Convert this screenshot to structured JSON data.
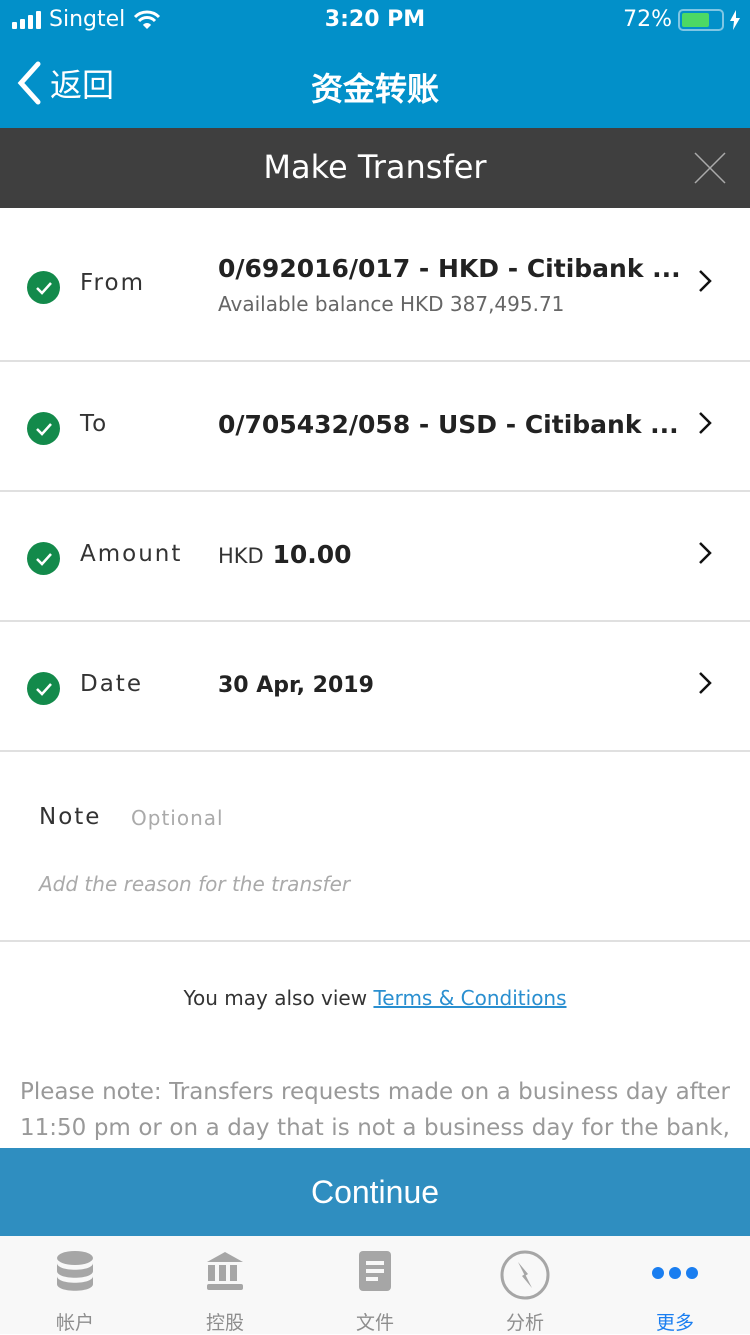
{
  "status": {
    "carrier": "Singtel",
    "time": "3:20 PM",
    "battery": "72%",
    "battery_level": 0.72
  },
  "nav": {
    "back": "返回",
    "title": "资金转账"
  },
  "modal": {
    "title": "Make Transfer"
  },
  "rows": [
    {
      "label": "From",
      "value": "0/692016/017 - HKD - Citibank ...",
      "sub": "Available balance HKD 387,495.71"
    },
    {
      "label": "To",
      "value": "0/705432/058 - USD - Citibank ..."
    },
    {
      "label": "Amount",
      "currency": "HKD",
      "value": "10.00"
    },
    {
      "label": "Date",
      "value": "30 Apr, 2019"
    }
  ],
  "note": {
    "label": "Note",
    "optional": "Optional",
    "placeholder": "Add the reason for the transfer"
  },
  "terms": {
    "prefix": "You may also view ",
    "link": "Terms & Conditions"
  },
  "please_note": "Please note: Transfers requests made on a business day after 11:50 pm or on a day that is not a business day for the bank, will",
  "continue": "Continue",
  "tabs": [
    {
      "label": "帐户"
    },
    {
      "label": "控股"
    },
    {
      "label": "文件"
    },
    {
      "label": "分析"
    },
    {
      "label": "更多"
    }
  ],
  "colors": {
    "primary": "#0290c9",
    "check": "#138a4b",
    "active_tab": "#1a7ef0"
  }
}
